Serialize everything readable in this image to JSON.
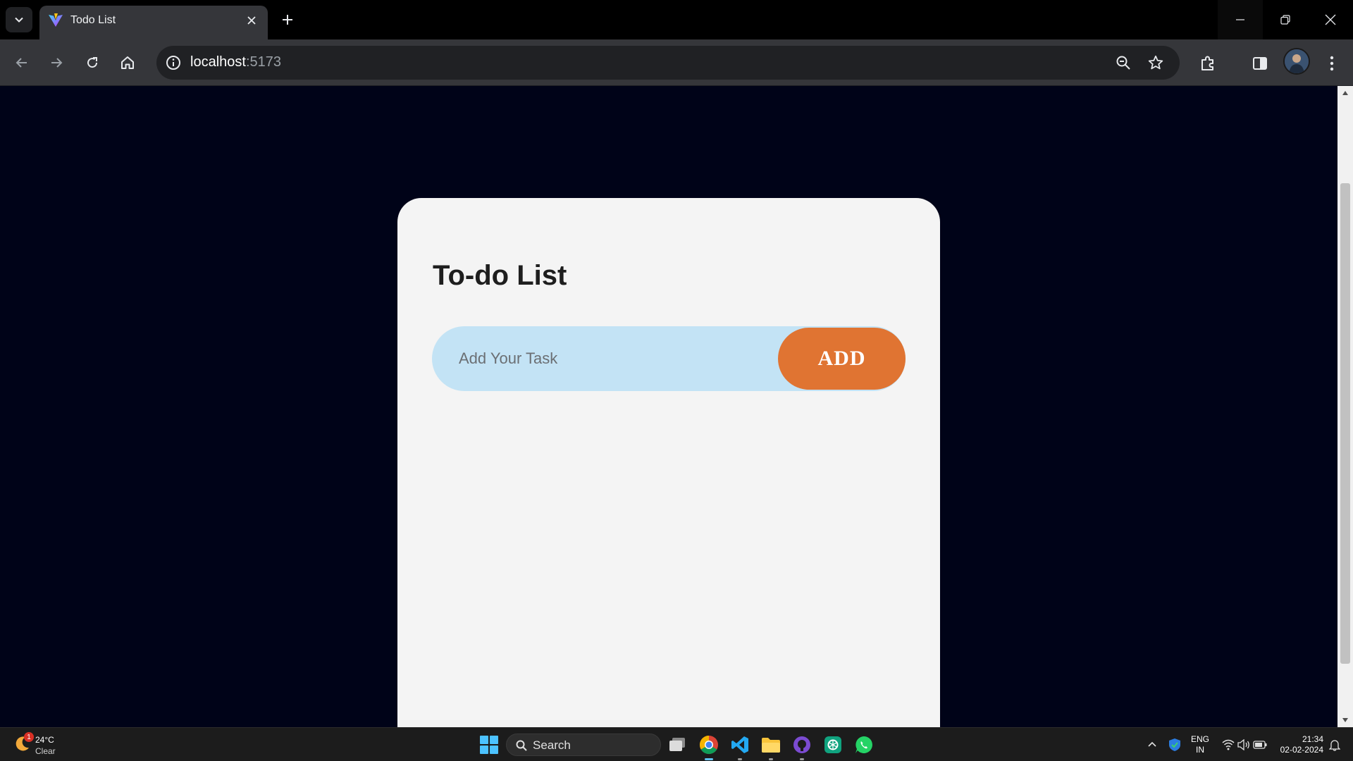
{
  "browser": {
    "tab_title": "Todo List",
    "url_host": "localhost",
    "url_port": ":5173"
  },
  "page": {
    "heading": "To-do List",
    "task_placeholder": "Add Your Task",
    "add_label": "ADD"
  },
  "taskbar": {
    "weather_temp": "24°C",
    "weather_condition": "Clear",
    "weather_badge": "1",
    "search_label": "Search",
    "lang_top": "ENG",
    "lang_bottom": "IN",
    "time": "21:34",
    "date": "02-02-2024"
  },
  "colors": {
    "page_bg": "#000318",
    "card_bg": "#f4f4f4",
    "input_bg": "#c3e3f5",
    "add_button": "#e07432"
  }
}
